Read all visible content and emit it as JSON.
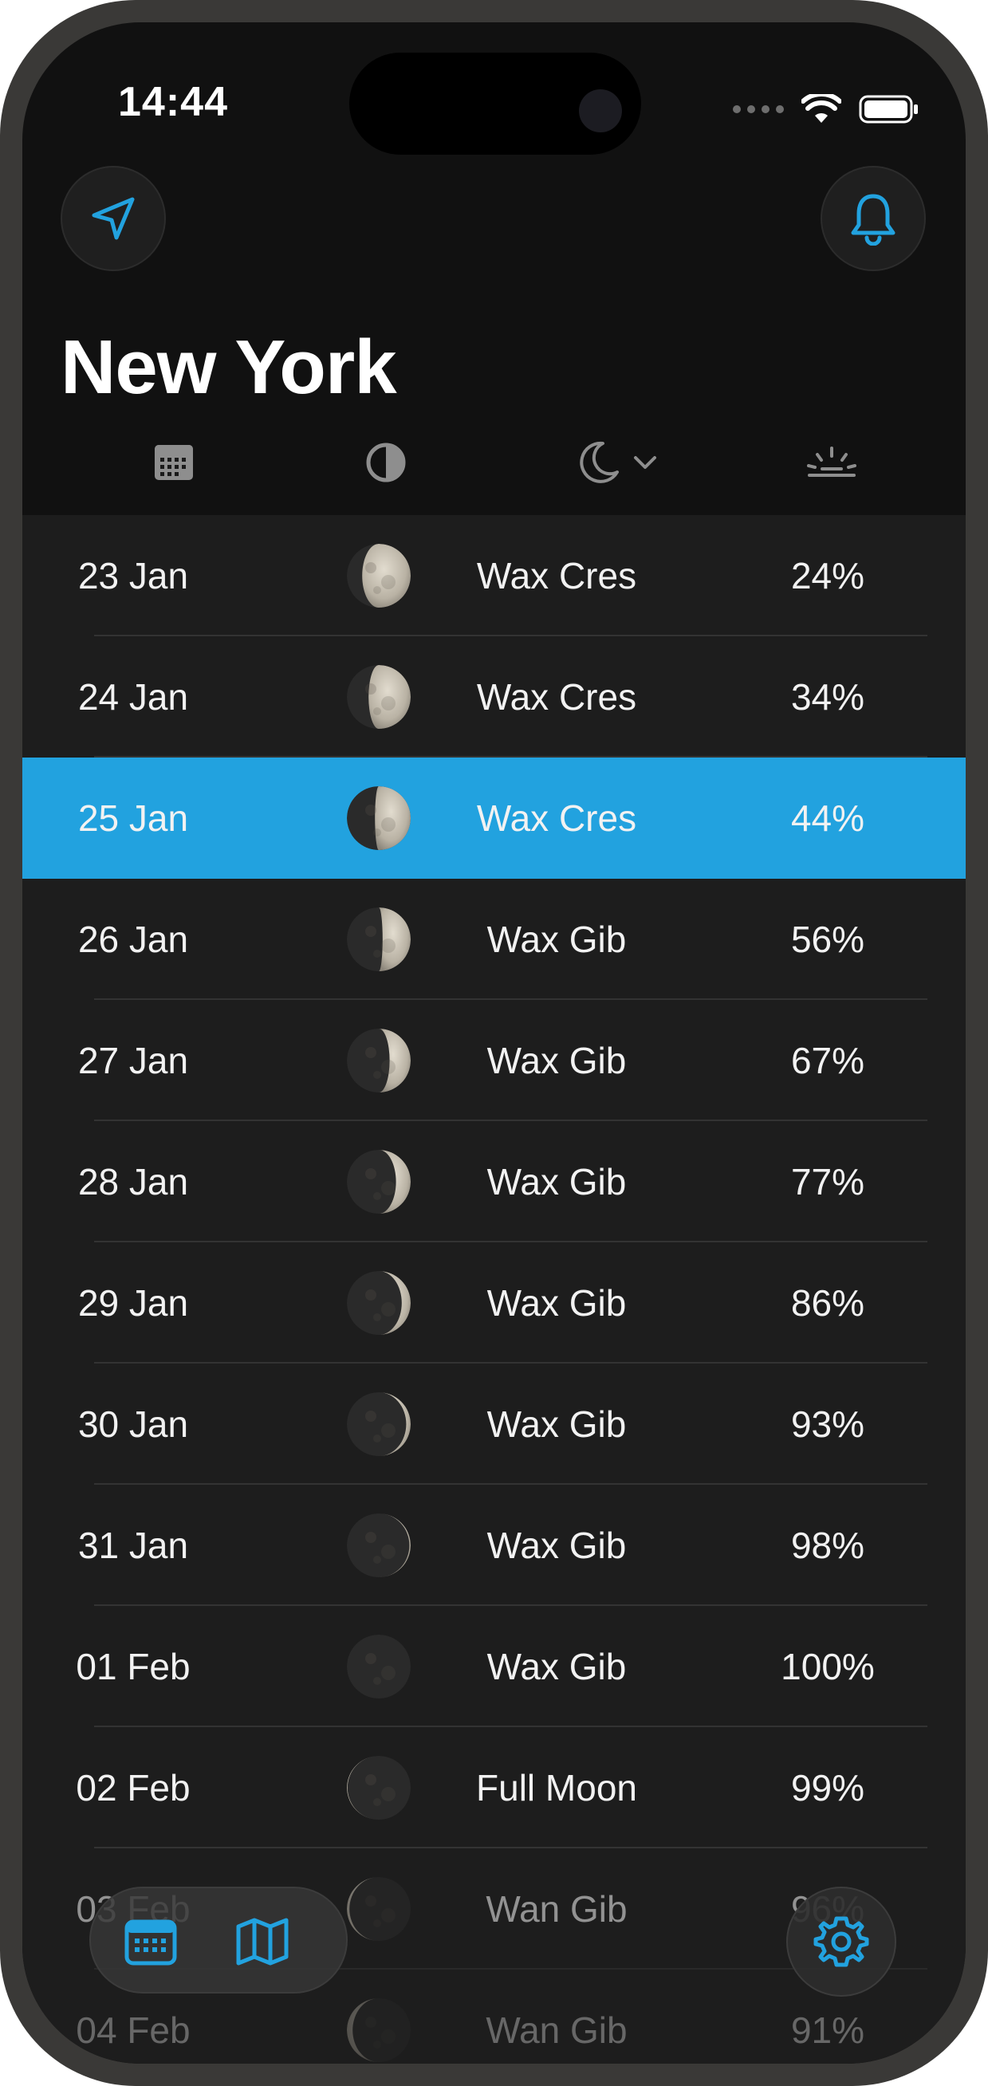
{
  "status_bar": {
    "time": "14:44"
  },
  "header": {
    "city": "New York"
  },
  "colors": {
    "accent": "#22a2df",
    "background": "#111111",
    "row_bg": "#1d1d1d"
  },
  "icons": {
    "location": "location-arrow-icon",
    "alerts": "bell-icon",
    "col_date": "calendar-icon",
    "col_phase": "moon-phase-icon",
    "col_phase_name": "crescent-moon-icon",
    "col_phase_dropdown": "chevron-down-icon",
    "col_illumination": "sunrise-icon",
    "tab_calendar": "calendar-icon",
    "tab_map": "map-icon",
    "settings": "gear-icon"
  },
  "rows": [
    {
      "date": "23 Jan",
      "phase": "Wax Cres",
      "illumination": "24%",
      "fraction": 0.24,
      "waxing": true
    },
    {
      "date": "24 Jan",
      "phase": "Wax Cres",
      "illumination": "34%",
      "fraction": 0.34,
      "waxing": true
    },
    {
      "date": "25 Jan",
      "phase": "Wax Cres",
      "illumination": "44%",
      "fraction": 0.44,
      "waxing": true,
      "selected": true
    },
    {
      "date": "26 Jan",
      "phase": "Wax Gib",
      "illumination": "56%",
      "fraction": 0.56,
      "waxing": true
    },
    {
      "date": "27 Jan",
      "phase": "Wax Gib",
      "illumination": "67%",
      "fraction": 0.67,
      "waxing": true
    },
    {
      "date": "28 Jan",
      "phase": "Wax Gib",
      "illumination": "77%",
      "fraction": 0.77,
      "waxing": true
    },
    {
      "date": "29 Jan",
      "phase": "Wax Gib",
      "illumination": "86%",
      "fraction": 0.86,
      "waxing": true
    },
    {
      "date": "30 Jan",
      "phase": "Wax Gib",
      "illumination": "93%",
      "fraction": 0.93,
      "waxing": true
    },
    {
      "date": "31 Jan",
      "phase": "Wax Gib",
      "illumination": "98%",
      "fraction": 0.98,
      "waxing": true
    },
    {
      "date": "01 Feb",
      "phase": "Wax Gib",
      "illumination": "100%",
      "fraction": 1.0,
      "waxing": true
    },
    {
      "date": "02 Feb",
      "phase": "Full Moon",
      "illumination": "99%",
      "fraction": 0.99,
      "waxing": false
    },
    {
      "date": "03 Feb",
      "phase": "Wan Gib",
      "illumination": "96%",
      "fraction": 0.96,
      "waxing": false
    },
    {
      "date": "04 Feb",
      "phase": "Wan Gib",
      "illumination": "91%",
      "fraction": 0.91,
      "waxing": false
    }
  ]
}
